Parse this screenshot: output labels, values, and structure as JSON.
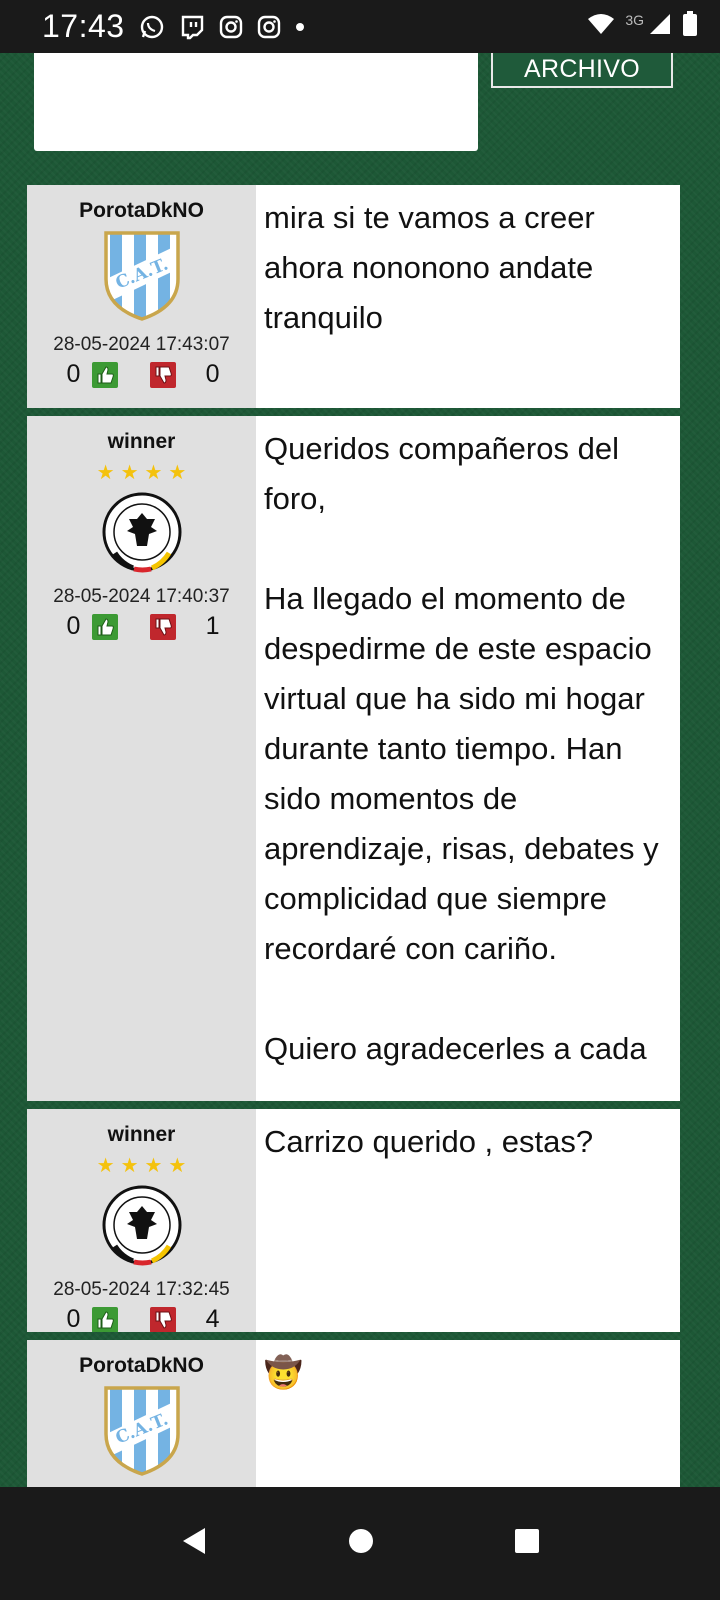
{
  "status_bar": {
    "time": "17:43",
    "network": "3G",
    "app_icons": [
      "whatsapp-icon",
      "twitch-icon",
      "instagram-icon",
      "instagram-icon",
      "dot-icon"
    ],
    "system_icons": [
      "wifi-icon",
      "signal-icon",
      "battery-icon"
    ]
  },
  "header": {
    "archivo_label": "ARCHIVO"
  },
  "posts": [
    {
      "username": "PorotaDkNO",
      "stars": "",
      "avatar": "cat-crest",
      "date": "28-05-2024 17:43:07",
      "likes": "0",
      "dislikes": "0",
      "text": "mira si te vamos a creer ahora nononono andate tranquilo"
    },
    {
      "username": "winner",
      "stars": "★★★★",
      "avatar": "dfb-crest",
      "date": "28-05-2024 17:40:37",
      "likes": "0",
      "dislikes": "1",
      "text": "Queridos compañeros del foro,\n\nHa llegado el momento de despedirme de este espacio virtual que ha sido mi hogar durante tanto tiempo. Han sido momentos de aprendizaje, risas, debates y complicidad que siempre recordaré con cariño.\n\nQuiero agradecerles a cada"
    },
    {
      "username": "winner",
      "stars": "★★★★",
      "avatar": "dfb-crest",
      "date": "28-05-2024 17:32:45",
      "likes": "0",
      "dislikes": "4",
      "text": "Carrizo querido , estas?"
    },
    {
      "username": "PorotaDkNO",
      "stars": "",
      "avatar": "cat-crest",
      "date": "",
      "likes": "",
      "dislikes": "",
      "text": "🤠"
    }
  ],
  "nav_bar": {
    "buttons": [
      "back-icon",
      "home-icon",
      "recents-icon"
    ]
  },
  "colors": {
    "page_bg": "#1d5836",
    "side_bg": "#e0e0e0",
    "like": "#3c9a34",
    "dislike": "#c0272d",
    "stars": "#f4c20d"
  }
}
